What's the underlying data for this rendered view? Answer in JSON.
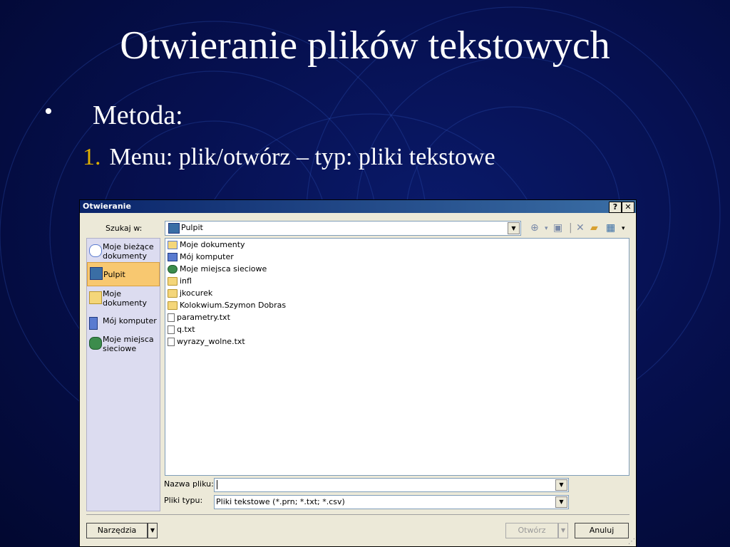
{
  "slide": {
    "title": "Otwieranie plików tekstowych",
    "bullet": "•",
    "bullet_text": "Metoda:",
    "numbered_label": "1.",
    "numbered_text": "Menu: plik/otwórz – typ: pliki tekstowe"
  },
  "dialog": {
    "title": "Otwieranie",
    "help_btn": "?",
    "close_btn": "✕",
    "look_in_label": "Szukaj w:",
    "look_in_value": "Pulpit",
    "places": [
      {
        "label": "Moje bieżące dokumenty",
        "icon": "recent-docs-icon"
      },
      {
        "label": "Pulpit",
        "icon": "desktop-icon"
      },
      {
        "label": "Moje dokumenty",
        "icon": "my-documents-icon"
      },
      {
        "label": "Mój komputer",
        "icon": "my-computer-icon"
      },
      {
        "label": "Moje miejsca sieciowe",
        "icon": "network-places-icon"
      }
    ],
    "files": [
      {
        "name": "Moje dokumenty",
        "icon": "my-documents-icon"
      },
      {
        "name": "Mój komputer",
        "icon": "computer-icon"
      },
      {
        "name": "Moje miejsca sieciowe",
        "icon": "network-icon"
      },
      {
        "name": "infl",
        "icon": "folder-icon"
      },
      {
        "name": "jkocurek",
        "icon": "folder-icon"
      },
      {
        "name": "Kolokwium.Szymon Dobras",
        "icon": "folder-icon"
      },
      {
        "name": "parametry.txt",
        "icon": "text-file-icon"
      },
      {
        "name": "q.txt",
        "icon": "text-file-icon"
      },
      {
        "name": "wyrazy_wolne.txt",
        "icon": "text-file-icon"
      }
    ],
    "filename_label": "Nazwa pliku:",
    "filename_value": "",
    "filetype_label": "Pliki typu:",
    "filetype_value": "Pliki tekstowe (*.prn; *.txt; *.csv)",
    "tools_button": "Narzędzia",
    "open_button": "Otwórz",
    "cancel_button": "Anuluj"
  }
}
